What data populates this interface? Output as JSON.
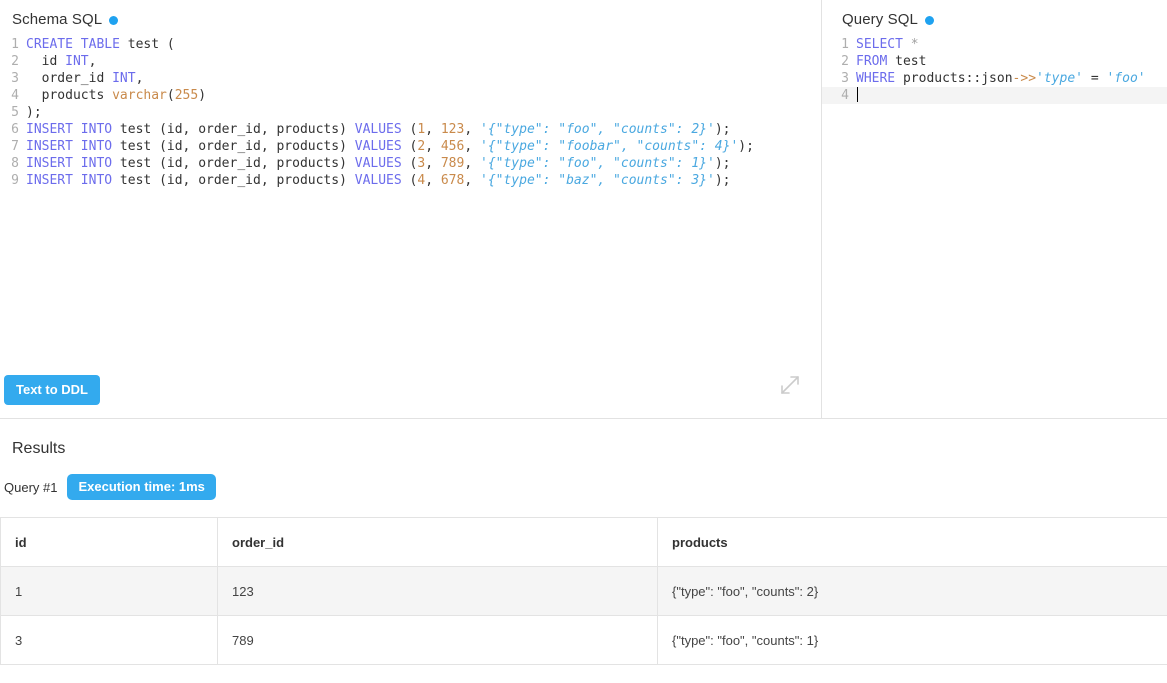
{
  "schema_panel": {
    "title": "Schema SQL",
    "status_dot_color": "#1fa2f0",
    "button_label": "Text to DDL",
    "resize_icon": "expand-diagonal-icon",
    "lines": [
      {
        "n": "1",
        "tokens": [
          {
            "t": "CREATE",
            "c": "kw"
          },
          {
            "t": " ",
            "c": "plain"
          },
          {
            "t": "TABLE",
            "c": "kw"
          },
          {
            "t": " test (",
            "c": "plain"
          }
        ]
      },
      {
        "n": "2",
        "tokens": [
          {
            "t": "  id ",
            "c": "plain"
          },
          {
            "t": "INT",
            "c": "typ"
          },
          {
            "t": ",",
            "c": "plain"
          }
        ]
      },
      {
        "n": "3",
        "tokens": [
          {
            "t": "  order_id ",
            "c": "plain"
          },
          {
            "t": "INT",
            "c": "typ"
          },
          {
            "t": ",",
            "c": "plain"
          }
        ]
      },
      {
        "n": "4",
        "tokens": [
          {
            "t": "  products ",
            "c": "plain"
          },
          {
            "t": "varchar",
            "c": "fn"
          },
          {
            "t": "(",
            "c": "plain"
          },
          {
            "t": "255",
            "c": "num"
          },
          {
            "t": ")",
            "c": "plain"
          }
        ]
      },
      {
        "n": "5",
        "tokens": [
          {
            "t": ");",
            "c": "plain"
          }
        ]
      },
      {
        "n": "6",
        "tokens": [
          {
            "t": "INSERT",
            "c": "kw"
          },
          {
            "t": " ",
            "c": "plain"
          },
          {
            "t": "INTO",
            "c": "kw"
          },
          {
            "t": " test (id, order_id, products) ",
            "c": "plain"
          },
          {
            "t": "VALUES",
            "c": "kw"
          },
          {
            "t": " (",
            "c": "plain"
          },
          {
            "t": "1",
            "c": "num"
          },
          {
            "t": ", ",
            "c": "plain"
          },
          {
            "t": "123",
            "c": "num"
          },
          {
            "t": ", ",
            "c": "plain"
          },
          {
            "t": "'{\"type\": \"foo\", \"counts\": 2}'",
            "c": "str"
          },
          {
            "t": ");",
            "c": "plain"
          }
        ]
      },
      {
        "n": "7",
        "tokens": [
          {
            "t": "INSERT",
            "c": "kw"
          },
          {
            "t": " ",
            "c": "plain"
          },
          {
            "t": "INTO",
            "c": "kw"
          },
          {
            "t": " test (id, order_id, products) ",
            "c": "plain"
          },
          {
            "t": "VALUES",
            "c": "kw"
          },
          {
            "t": " (",
            "c": "plain"
          },
          {
            "t": "2",
            "c": "num"
          },
          {
            "t": ", ",
            "c": "plain"
          },
          {
            "t": "456",
            "c": "num"
          },
          {
            "t": ", ",
            "c": "plain"
          },
          {
            "t": "'{\"type\": \"foobar\", \"counts\": 4}'",
            "c": "str"
          },
          {
            "t": ");",
            "c": "plain"
          }
        ]
      },
      {
        "n": "8",
        "tokens": [
          {
            "t": "INSERT",
            "c": "kw"
          },
          {
            "t": " ",
            "c": "plain"
          },
          {
            "t": "INTO",
            "c": "kw"
          },
          {
            "t": " test (id, order_id, products) ",
            "c": "plain"
          },
          {
            "t": "VALUES",
            "c": "kw"
          },
          {
            "t": " (",
            "c": "plain"
          },
          {
            "t": "3",
            "c": "num"
          },
          {
            "t": ", ",
            "c": "plain"
          },
          {
            "t": "789",
            "c": "num"
          },
          {
            "t": ", ",
            "c": "plain"
          },
          {
            "t": "'{\"type\": \"foo\", \"counts\": 1}'",
            "c": "str"
          },
          {
            "t": ");",
            "c": "plain"
          }
        ]
      },
      {
        "n": "9",
        "tokens": [
          {
            "t": "INSERT",
            "c": "kw"
          },
          {
            "t": " ",
            "c": "plain"
          },
          {
            "t": "INTO",
            "c": "kw"
          },
          {
            "t": " test (id, order_id, products) ",
            "c": "plain"
          },
          {
            "t": "VALUES",
            "c": "kw"
          },
          {
            "t": " (",
            "c": "plain"
          },
          {
            "t": "4",
            "c": "num"
          },
          {
            "t": ", ",
            "c": "plain"
          },
          {
            "t": "678",
            "c": "num"
          },
          {
            "t": ", ",
            "c": "plain"
          },
          {
            "t": "'{\"type\": \"baz\", \"counts\": 3}'",
            "c": "str"
          },
          {
            "t": ");",
            "c": "plain"
          }
        ]
      }
    ]
  },
  "query_panel": {
    "title": "Query SQL",
    "status_dot_color": "#1fa2f0",
    "lines": [
      {
        "n": "1",
        "active": false,
        "tokens": [
          {
            "t": "SELECT",
            "c": "kw"
          },
          {
            "t": " ",
            "c": "plain"
          },
          {
            "t": "*",
            "c": "atom"
          }
        ]
      },
      {
        "n": "2",
        "active": false,
        "tokens": [
          {
            "t": "FROM",
            "c": "kw"
          },
          {
            "t": " test",
            "c": "plain"
          }
        ]
      },
      {
        "n": "3",
        "active": false,
        "tokens": [
          {
            "t": "WHERE",
            "c": "kw"
          },
          {
            "t": " products::json",
            "c": "plain"
          },
          {
            "t": "->>",
            "c": "op"
          },
          {
            "t": "'type'",
            "c": "str"
          },
          {
            "t": " = ",
            "c": "plain"
          },
          {
            "t": "'foo'",
            "c": "str"
          }
        ]
      },
      {
        "n": "4",
        "active": true,
        "cursor": true,
        "tokens": []
      }
    ]
  },
  "results": {
    "title": "Results",
    "query_label": "Query #1",
    "execution_badge": "Execution time: 1ms",
    "accent_color": "#33aaee",
    "columns": [
      "id",
      "order_id",
      "products"
    ],
    "rows": [
      [
        "1",
        "123",
        "{\"type\": \"foo\", \"counts\": 2}"
      ],
      [
        "3",
        "789",
        "{\"type\": \"foo\", \"counts\": 1}"
      ]
    ]
  }
}
